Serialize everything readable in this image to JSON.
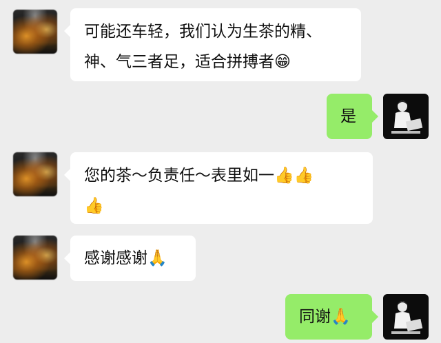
{
  "messages": [
    {
      "sender": "other",
      "lines": [
        "可能还车轻，我们认为生茶的精、",
        "神、气三者足，适合拼搏者😁"
      ]
    },
    {
      "sender": "me",
      "lines": [
        "是"
      ]
    },
    {
      "sender": "other",
      "lines": [
        "您的茶～负责任～表里如一👍👍",
        "👍"
      ]
    },
    {
      "sender": "other",
      "lines": [
        "感谢感谢🙏"
      ]
    },
    {
      "sender": "me",
      "lines": [
        "同谢🙏"
      ]
    }
  ],
  "colors": {
    "background": "#ededed",
    "incoming_bubble": "#ffffff",
    "outgoing_bubble": "#95ec69",
    "text": "#111111"
  }
}
